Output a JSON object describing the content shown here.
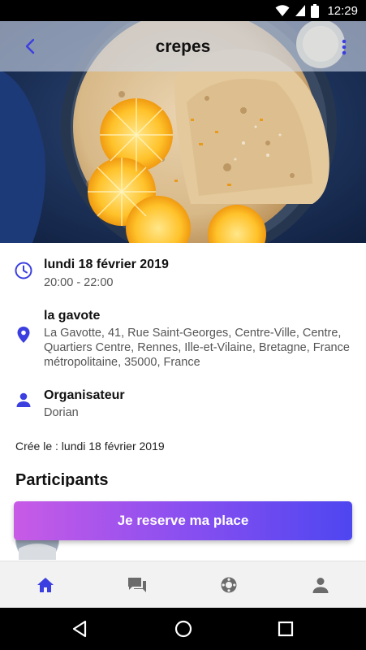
{
  "status_bar": {
    "time": "12:29",
    "icons": [
      "wifi-icon",
      "signal-icon",
      "battery-icon"
    ]
  },
  "header": {
    "title": "crepes",
    "back_icon": "chevron-left-icon",
    "menu_icon": "more-vert-icon"
  },
  "hero_image": {
    "subject": "crepes-with-orange-slices"
  },
  "event": {
    "date": "lundi 18 février 2019",
    "time_range": "20:00 - 22:00",
    "place_name": "la gavote",
    "address": "La Gavotte, 41, Rue Saint-Georges, Centre-Ville, Centre, Quartiers Centre, Rennes, Ille-et-Vilaine, Bretagne, France métropolitaine, 35000, France",
    "organizer_label": "Organisateur",
    "organizer_name": "Dorian",
    "created": "Crée le : lundi 18 février 2019",
    "participants_title": "Participants"
  },
  "actions": {
    "reserve_label": "Je reserve ma place"
  },
  "bottom_nav": [
    "home-icon",
    "chat-icon",
    "explore-icon",
    "account-icon"
  ],
  "system_nav": [
    "back-icon",
    "home-icon",
    "recents-icon"
  ],
  "colors": {
    "accent": "#3b3fe0",
    "gradient_start": "#c85be6",
    "gradient_end": "#4e46f0",
    "header_overlay": "#cdd6e8",
    "nav_bg": "#f2f2f2"
  }
}
